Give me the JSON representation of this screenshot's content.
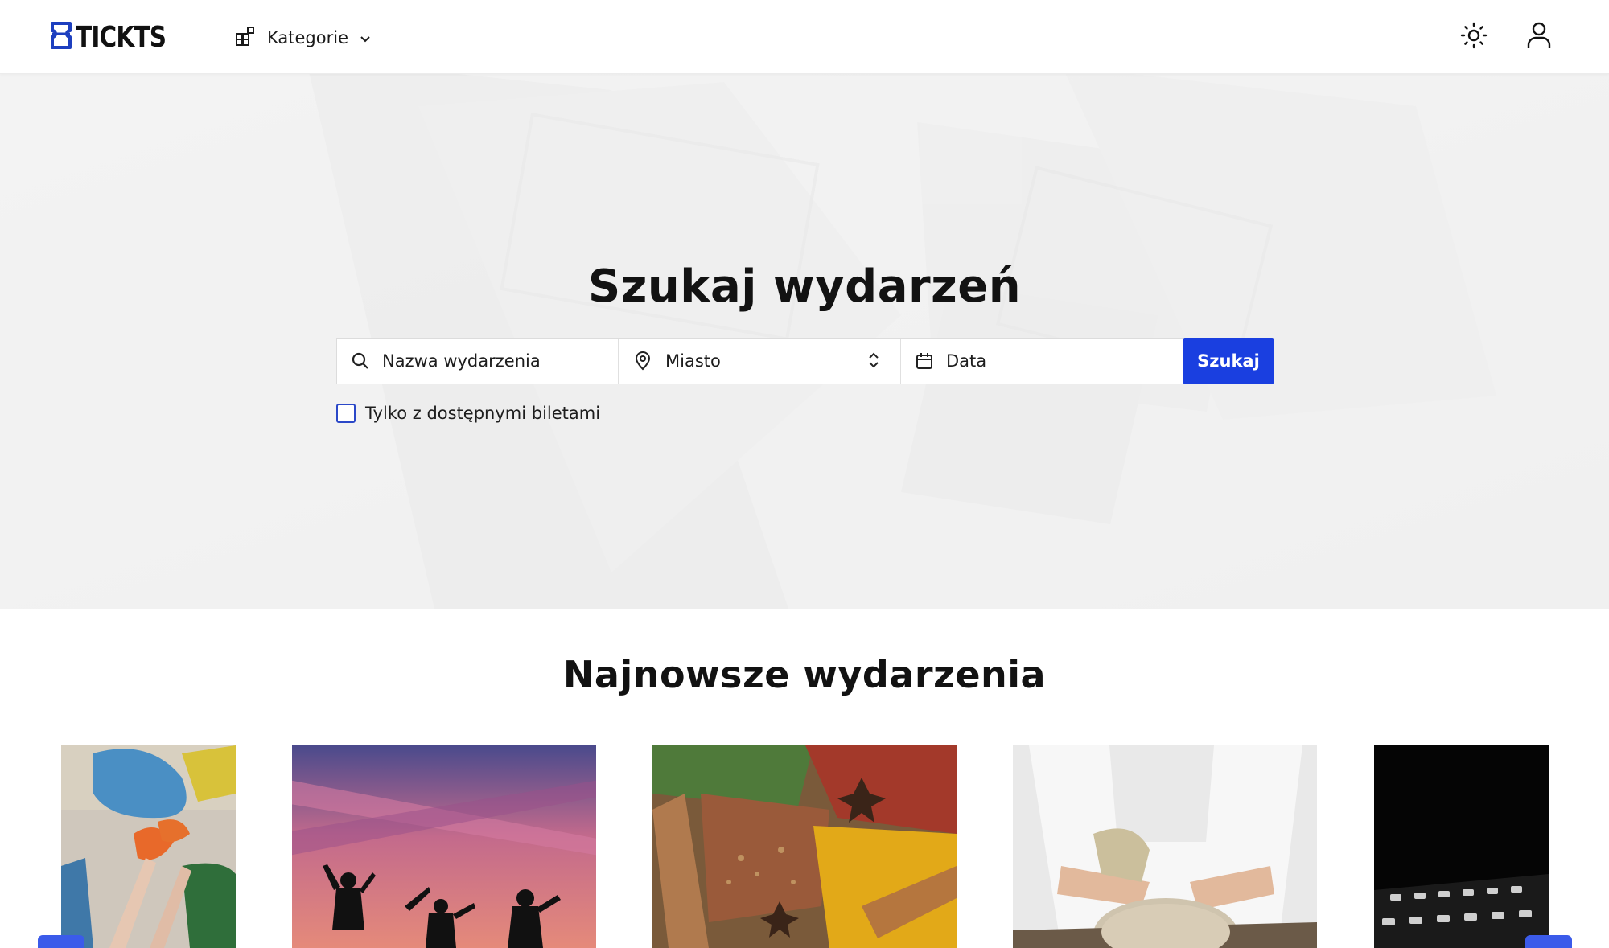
{
  "header": {
    "logo_text": "TICKTS",
    "categories_label": "Kategorie"
  },
  "hero": {
    "title": "Szukaj wydarzeń",
    "search": {
      "name_placeholder": "Nazwa wydarzenia",
      "city_placeholder": "Miasto",
      "date_placeholder": "Data",
      "button_label": "Szukaj"
    },
    "available_only_label": "Tylko z dostępnymi biletami"
  },
  "latest": {
    "title": "Najnowsze wydarzenia"
  },
  "icons": {
    "logo": "ticket-icon",
    "categories": "grid-icon",
    "chevron": "chevron-down-icon",
    "theme": "sun-icon",
    "account": "user-icon",
    "search": "search-icon",
    "location": "map-pin-icon",
    "select": "up-down-chevron-icon",
    "date": "calendar-icon"
  },
  "colors": {
    "accent": "#1a3fe0",
    "logo_accent": "#1d3fbf"
  }
}
